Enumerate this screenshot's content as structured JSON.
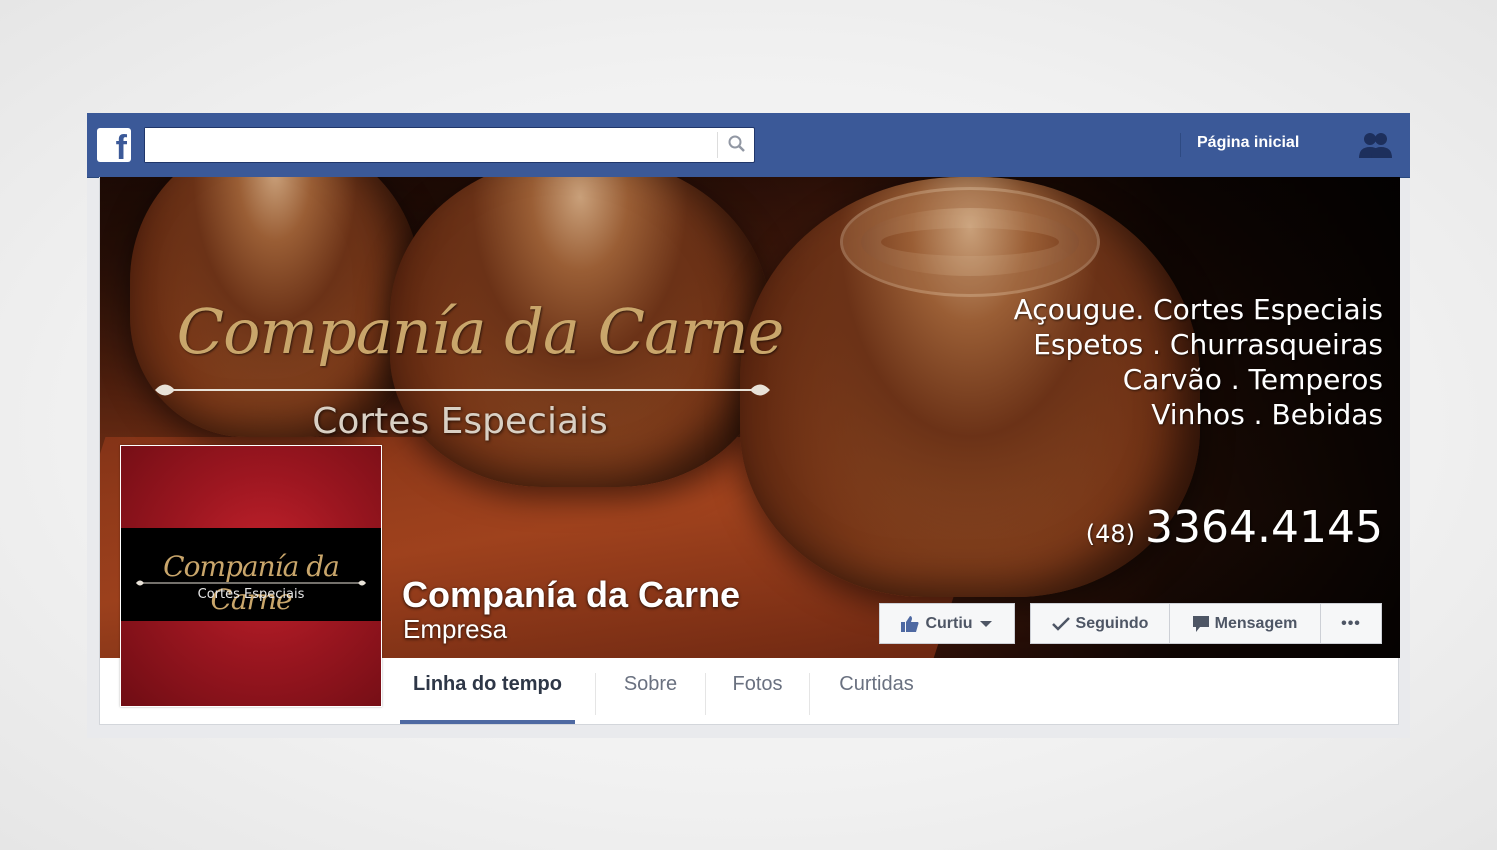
{
  "topbar": {
    "logo": "f",
    "search_placeholder": "",
    "home_label": "Página inicial",
    "icons": [
      "facebook-logo-icon",
      "search-icon",
      "friends-icon"
    ]
  },
  "cover": {
    "brand_script": "Companía da Carne",
    "brand_sub": "Cortes Especiais",
    "services": [
      "Açougue. Cortes Especiais",
      "Espetos . Churrasqueiras",
      "Carvão . Temperos",
      "Vinhos . Bebidas"
    ],
    "phone_ddd": "(48)",
    "phone_number": "3364.4145"
  },
  "page": {
    "name": "Companía da Carne",
    "category": "Empresa"
  },
  "profile": {
    "script": "Companía da Carne",
    "sub": "Cortes Especiais"
  },
  "actions": {
    "like": "Curtiu",
    "follow": "Seguindo",
    "message": "Mensagem",
    "more": "•••"
  },
  "tabs": [
    "Linha do tempo",
    "Sobre",
    "Fotos",
    "Curtidas"
  ],
  "colors": {
    "facebook_blue": "#3b5998",
    "tab_underline": "#4e69a2",
    "gold": "#c9a66b",
    "profile_red": "#9c1620"
  }
}
